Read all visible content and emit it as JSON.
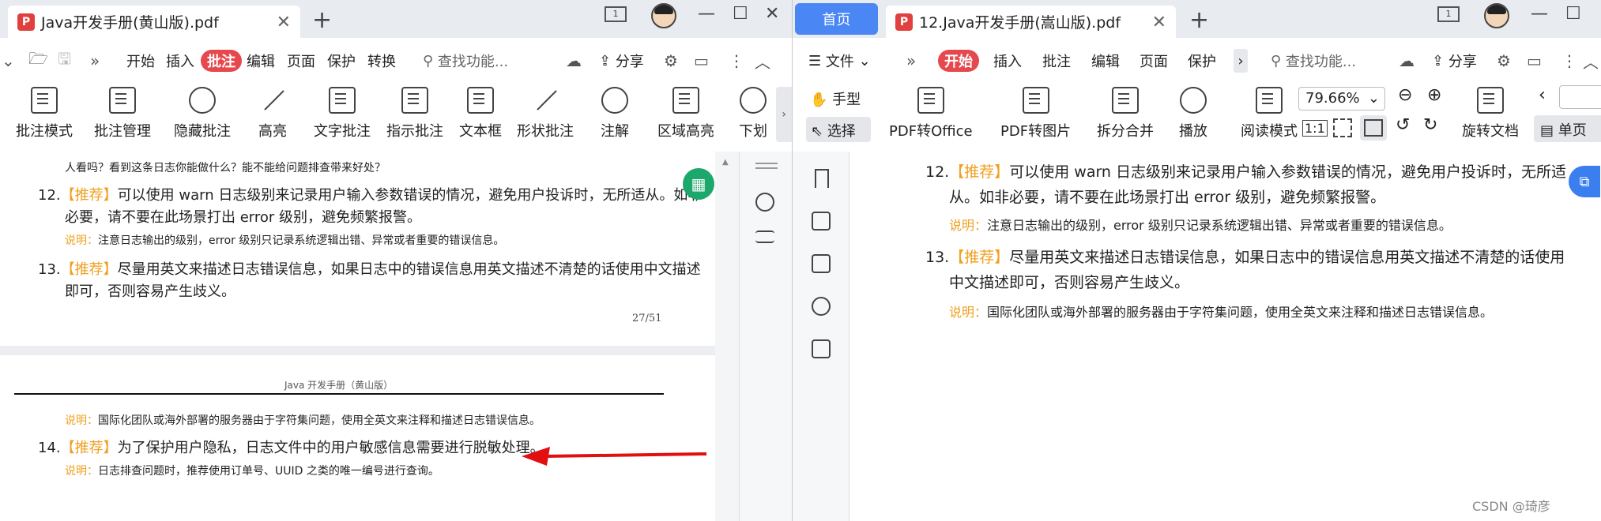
{
  "left": {
    "tab_title": "Java开发手册(黄山版).pdf",
    "menu": [
      "开始",
      "插入",
      "批注",
      "编辑",
      "页面",
      "保护",
      "转换"
    ],
    "active_menu": "批注",
    "search": "查找功能...",
    "share": "分享",
    "ribbon": [
      "批注模式",
      "批注管理",
      "隐藏批注",
      "高亮",
      "文字批注",
      "指示批注",
      "文本框",
      "形状批注",
      "注解",
      "区域高亮",
      "下划"
    ],
    "doc": {
      "top_cut": "人看吗？看到这条日志你能做什么？能不能给问题排查带来好处？",
      "item12_num": "12.",
      "item12_tag": "【推荐】",
      "item12_text_a": "可以使用 warn 日志级别来记录用户输入参数错误的情况，避免用户投诉时，无所适从。如非",
      "item12_text_b": "必要，请不要在此场景打出 error 级别，避免频繁报警。",
      "item12_note_k": "说明：",
      "item12_note": "注意日志输出的级别，error 级别只记录系统逻辑出错、异常或者重要的错误信息。",
      "item13_num": "13.",
      "item13_tag": "【推荐】",
      "item13_text_a": "尽量用英文来描述日志错误信息，如果日志中的错误信息用英文描述不清楚的话使用中文描述",
      "item13_text_b": "即可，否则容易产生歧义。",
      "page_no": "27/51",
      "header": "Java 开发手册（黄山版）",
      "item13_note_k": "说明：",
      "item13_note": "国际化团队或海外部署的服务器由于字符集问题，使用全英文来注释和描述日志错误信息。",
      "item14_num": "14.",
      "item14_tag": "【推荐】",
      "item14_text": "为了保护用户隐私，日志文件中的用户敏感信息需要进行脱敏处理。",
      "item14_note_k": "说明：",
      "item14_note": "日志排查问题时，推荐使用订单号、UUID 之类的唯一编号进行查询。"
    }
  },
  "right": {
    "home_tab": "首页",
    "tab_title": "12.Java开发手册(嵩山版).pdf",
    "menu_file": "文件",
    "menu": [
      "开始",
      "插入",
      "批注",
      "编辑",
      "页面",
      "保护"
    ],
    "active_menu": "开始",
    "search": "查找功能...",
    "share": "分享",
    "hand": "手型",
    "select": "选择",
    "ribbon": [
      "PDF转Office",
      "PDF转图片",
      "拆分合并",
      "播放",
      "阅读模式"
    ],
    "zoom": "79.66%",
    "rotate": "旋转文档",
    "single": "单页",
    "doc": {
      "item12_num": "12.",
      "item12_tag": "【推荐】",
      "item12_text_a": "可以使用 warn 日志级别来记录用户输入参数错误的情况，避免用户投诉时，无所适",
      "item12_text_b": "从。如非必要，请不要在此场景打出 error 级别，避免频繁报警。",
      "item12_note_k": "说明：",
      "item12_note": "注意日志输出的级别，error 级别只记录系统逻辑出错、异常或者重要的错误信息。",
      "item13_num": "13.",
      "item13_tag": "【推荐】",
      "item13_text_a": "尽量用英文来描述日志错误信息，如果日志中的错误信息用英文描述不清楚的话使用",
      "item13_text_b": "中文描述即可，否则容易产生歧义。",
      "item13_note_k": "说明：",
      "item13_note": "国际化团队或海外部署的服务器由于字符集问题，使用全英文来注释和描述日志错误信息。"
    },
    "watermark": "CSDN @琦彦"
  },
  "colors": {
    "active_menu": "#e5484d",
    "recommend": "#f0a020",
    "home_tab": "#4a86f4",
    "arrow": "#e01010"
  }
}
